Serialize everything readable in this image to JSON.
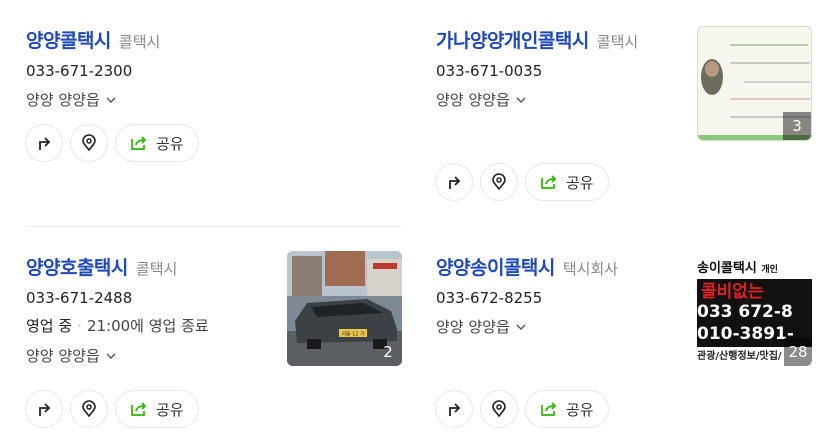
{
  "results": [
    {
      "name": "양양콜택시",
      "category": "콜택시",
      "phone": "033-671-2300",
      "address": "양양 양양읍",
      "share_label": "공유"
    },
    {
      "name": "가나양양개인콜택시",
      "category": "콜택시",
      "phone": "033-671-0035",
      "address": "양양 양양읍",
      "share_label": "공유",
      "photo_count": "3"
    },
    {
      "name": "양양호출택시",
      "category": "콜택시",
      "phone": "033-671-2488",
      "status": "영업 중",
      "hours_text": "21:00에 영업 종료",
      "address": "양양 양양읍",
      "share_label": "공유",
      "photo_count": "2"
    },
    {
      "name": "양양송이콜택시",
      "category": "택시회사",
      "phone": "033-672-8255",
      "address": "양양 양양읍",
      "share_label": "공유",
      "photo_count": "28"
    }
  ],
  "thumb_texts": {
    "sign_line1": "송이콜택시",
    "sign_individual": "개인",
    "sign_line2": "콜비없는",
    "sign_phone1": "033 672-8",
    "sign_phone2": "010-3891-",
    "sign_footer": "관광/산행정보/맛집/",
    "plate": "서울 12 가"
  },
  "colors": {
    "title": "#1f48b8",
    "share_icon": "#2db400"
  }
}
